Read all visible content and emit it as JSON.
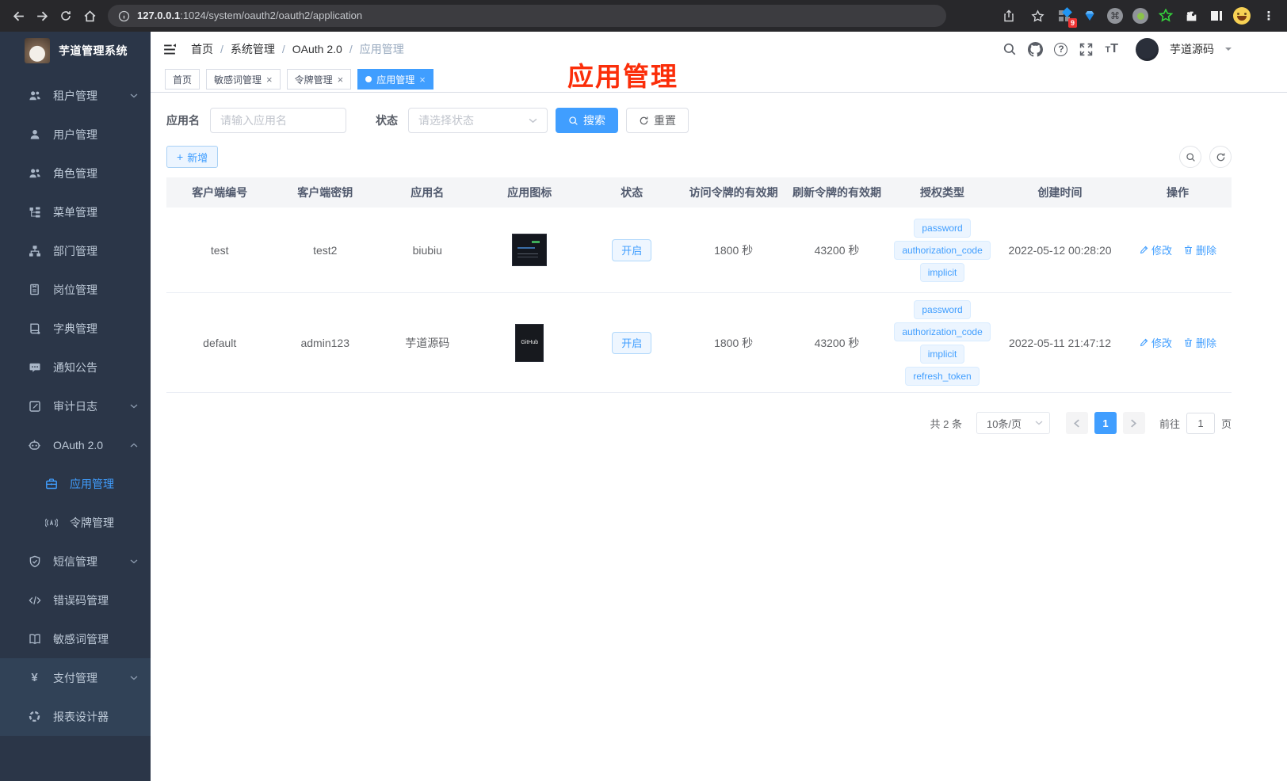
{
  "browser": {
    "url_host": "127.0.0.1",
    "url_path": ":1024/system/oauth2/oauth2/application",
    "extension_badge": "9"
  },
  "sidebar": {
    "title": "芋道管理系统",
    "items": [
      {
        "label": "租户管理",
        "icon": "users-icon",
        "expandable": true
      },
      {
        "label": "用户管理",
        "icon": "user-icon"
      },
      {
        "label": "角色管理",
        "icon": "role-icon"
      },
      {
        "label": "菜单管理",
        "icon": "menu-tree-icon"
      },
      {
        "label": "部门管理",
        "icon": "department-icon"
      },
      {
        "label": "岗位管理",
        "icon": "post-icon"
      },
      {
        "label": "字典管理",
        "icon": "dictionary-icon"
      },
      {
        "label": "通知公告",
        "icon": "notice-icon"
      },
      {
        "label": "审计日志",
        "icon": "audit-log-icon",
        "expandable": true
      },
      {
        "label": "OAuth 2.0",
        "icon": "oauth-robot-icon",
        "expandable": true,
        "expanded": true
      },
      {
        "label": "应用管理",
        "icon": "application-icon",
        "child": true,
        "active": true
      },
      {
        "label": "令牌管理",
        "icon": "token-icon",
        "child": true
      },
      {
        "label": "短信管理",
        "icon": "sms-shield-icon",
        "expandable": true
      },
      {
        "label": "错误码管理",
        "icon": "error-code-icon"
      },
      {
        "label": "敏感词管理",
        "icon": "sensitive-word-icon"
      },
      {
        "label": "支付管理",
        "icon": "payment-yen-icon",
        "expandable": true
      },
      {
        "label": "报表设计器",
        "icon": "report-designer-icon"
      }
    ]
  },
  "navbar": {
    "breadcrumb": [
      "首页",
      "系统管理",
      "OAuth 2.0",
      "应用管理"
    ],
    "username": "芋道源码"
  },
  "tabs": {
    "items": [
      {
        "label": "首页",
        "closable": false,
        "active": false
      },
      {
        "label": "敏感词管理",
        "closable": true,
        "active": false
      },
      {
        "label": "令牌管理",
        "closable": true,
        "active": false
      },
      {
        "label": "应用管理",
        "closable": true,
        "active": true
      }
    ]
  },
  "annotation": {
    "text": "应用管理",
    "color": "#fb2e0a"
  },
  "filters": {
    "name_label": "应用名",
    "name_placeholder": "请输入应用名",
    "status_label": "状态",
    "status_placeholder": "请选择状态",
    "search_label": "搜索",
    "reset_label": "重置"
  },
  "toolbar": {
    "add_label": "新增"
  },
  "table": {
    "headers": [
      "客户端编号",
      "客户端密钥",
      "应用名",
      "应用图标",
      "状态",
      "访问令牌的有效期",
      "刷新令牌的有效期",
      "授权类型",
      "创建时间",
      "操作"
    ],
    "actions": {
      "edit": "修改",
      "delete": "删除"
    },
    "rows": [
      {
        "client_id": "test",
        "client_secret": "test2",
        "app_name": "biubiu",
        "status": "开启",
        "access_token_ttl": "1800 秒",
        "refresh_token_ttl": "43200 秒",
        "grant_types": [
          "password",
          "authorization_code",
          "implicit"
        ],
        "created_at": "2022-05-12 00:28:20"
      },
      {
        "client_id": "default",
        "client_secret": "admin123",
        "app_name": "芋道源码",
        "status": "开启",
        "access_token_ttl": "1800 秒",
        "refresh_token_ttl": "43200 秒",
        "grant_types": [
          "password",
          "authorization_code",
          "implicit",
          "refresh_token"
        ],
        "created_at": "2022-05-11 21:47:12",
        "icon_label": "GitHub"
      }
    ]
  },
  "pagination": {
    "total": "共 2 条",
    "page_size": "10条/页",
    "current_page": "1",
    "goto_label": "前往",
    "goto_value": "1",
    "page_unit": "页"
  },
  "colors": {
    "accent": "#409eff",
    "sidebar_bg": "#2b3648",
    "annotation_red": "#fb2e0a"
  }
}
